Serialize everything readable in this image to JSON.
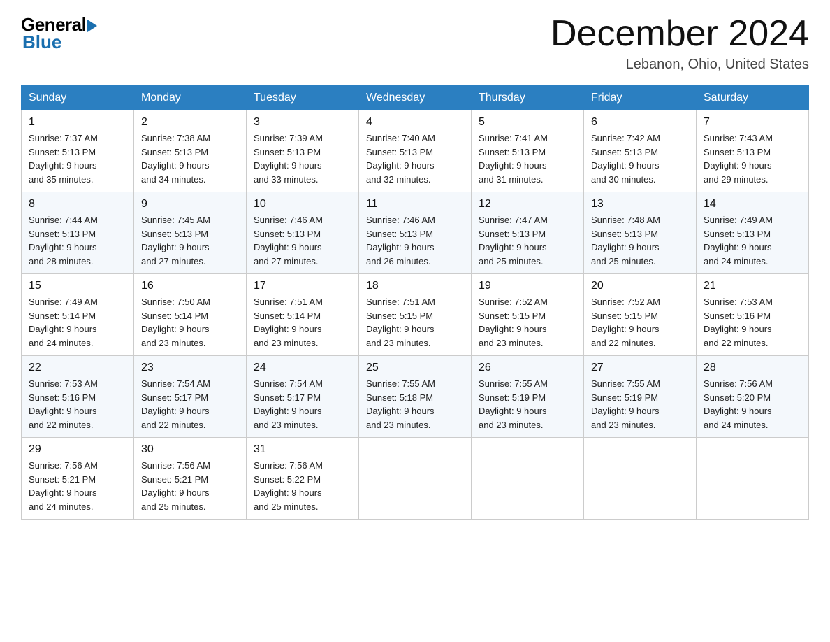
{
  "logo": {
    "general": "General",
    "blue": "Blue"
  },
  "title": "December 2024",
  "location": "Lebanon, Ohio, United States",
  "weekdays": [
    "Sunday",
    "Monday",
    "Tuesday",
    "Wednesday",
    "Thursday",
    "Friday",
    "Saturday"
  ],
  "weeks": [
    [
      {
        "day": 1,
        "sunrise": "7:37 AM",
        "sunset": "5:13 PM",
        "daylight": "9 hours and 35 minutes."
      },
      {
        "day": 2,
        "sunrise": "7:38 AM",
        "sunset": "5:13 PM",
        "daylight": "9 hours and 34 minutes."
      },
      {
        "day": 3,
        "sunrise": "7:39 AM",
        "sunset": "5:13 PM",
        "daylight": "9 hours and 33 minutes."
      },
      {
        "day": 4,
        "sunrise": "7:40 AM",
        "sunset": "5:13 PM",
        "daylight": "9 hours and 32 minutes."
      },
      {
        "day": 5,
        "sunrise": "7:41 AM",
        "sunset": "5:13 PM",
        "daylight": "9 hours and 31 minutes."
      },
      {
        "day": 6,
        "sunrise": "7:42 AM",
        "sunset": "5:13 PM",
        "daylight": "9 hours and 30 minutes."
      },
      {
        "day": 7,
        "sunrise": "7:43 AM",
        "sunset": "5:13 PM",
        "daylight": "9 hours and 29 minutes."
      }
    ],
    [
      {
        "day": 8,
        "sunrise": "7:44 AM",
        "sunset": "5:13 PM",
        "daylight": "9 hours and 28 minutes."
      },
      {
        "day": 9,
        "sunrise": "7:45 AM",
        "sunset": "5:13 PM",
        "daylight": "9 hours and 27 minutes."
      },
      {
        "day": 10,
        "sunrise": "7:46 AM",
        "sunset": "5:13 PM",
        "daylight": "9 hours and 27 minutes."
      },
      {
        "day": 11,
        "sunrise": "7:46 AM",
        "sunset": "5:13 PM",
        "daylight": "9 hours and 26 minutes."
      },
      {
        "day": 12,
        "sunrise": "7:47 AM",
        "sunset": "5:13 PM",
        "daylight": "9 hours and 25 minutes."
      },
      {
        "day": 13,
        "sunrise": "7:48 AM",
        "sunset": "5:13 PM",
        "daylight": "9 hours and 25 minutes."
      },
      {
        "day": 14,
        "sunrise": "7:49 AM",
        "sunset": "5:13 PM",
        "daylight": "9 hours and 24 minutes."
      }
    ],
    [
      {
        "day": 15,
        "sunrise": "7:49 AM",
        "sunset": "5:14 PM",
        "daylight": "9 hours and 24 minutes."
      },
      {
        "day": 16,
        "sunrise": "7:50 AM",
        "sunset": "5:14 PM",
        "daylight": "9 hours and 23 minutes."
      },
      {
        "day": 17,
        "sunrise": "7:51 AM",
        "sunset": "5:14 PM",
        "daylight": "9 hours and 23 minutes."
      },
      {
        "day": 18,
        "sunrise": "7:51 AM",
        "sunset": "5:15 PM",
        "daylight": "9 hours and 23 minutes."
      },
      {
        "day": 19,
        "sunrise": "7:52 AM",
        "sunset": "5:15 PM",
        "daylight": "9 hours and 23 minutes."
      },
      {
        "day": 20,
        "sunrise": "7:52 AM",
        "sunset": "5:15 PM",
        "daylight": "9 hours and 22 minutes."
      },
      {
        "day": 21,
        "sunrise": "7:53 AM",
        "sunset": "5:16 PM",
        "daylight": "9 hours and 22 minutes."
      }
    ],
    [
      {
        "day": 22,
        "sunrise": "7:53 AM",
        "sunset": "5:16 PM",
        "daylight": "9 hours and 22 minutes."
      },
      {
        "day": 23,
        "sunrise": "7:54 AM",
        "sunset": "5:17 PM",
        "daylight": "9 hours and 22 minutes."
      },
      {
        "day": 24,
        "sunrise": "7:54 AM",
        "sunset": "5:17 PM",
        "daylight": "9 hours and 23 minutes."
      },
      {
        "day": 25,
        "sunrise": "7:55 AM",
        "sunset": "5:18 PM",
        "daylight": "9 hours and 23 minutes."
      },
      {
        "day": 26,
        "sunrise": "7:55 AM",
        "sunset": "5:19 PM",
        "daylight": "9 hours and 23 minutes."
      },
      {
        "day": 27,
        "sunrise": "7:55 AM",
        "sunset": "5:19 PM",
        "daylight": "9 hours and 23 minutes."
      },
      {
        "day": 28,
        "sunrise": "7:56 AM",
        "sunset": "5:20 PM",
        "daylight": "9 hours and 24 minutes."
      }
    ],
    [
      {
        "day": 29,
        "sunrise": "7:56 AM",
        "sunset": "5:21 PM",
        "daylight": "9 hours and 24 minutes."
      },
      {
        "day": 30,
        "sunrise": "7:56 AM",
        "sunset": "5:21 PM",
        "daylight": "9 hours and 25 minutes."
      },
      {
        "day": 31,
        "sunrise": "7:56 AM",
        "sunset": "5:22 PM",
        "daylight": "9 hours and 25 minutes."
      },
      null,
      null,
      null,
      null
    ]
  ]
}
